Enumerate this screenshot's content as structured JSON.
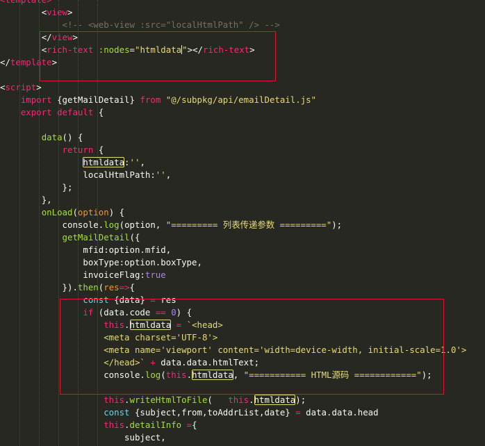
{
  "colors": {
    "background": "#272822",
    "plain": "#f8f8f2",
    "tag": "#f92672",
    "string": "#e6db74",
    "comment": "#75715e",
    "function": "#a6e22e",
    "param": "#fd971f",
    "constant": "#ae81ff",
    "storage": "#66d9ef",
    "highlight_box": "#e0112f"
  },
  "editor": {
    "lines": [
      [
        {
          "t": "<template>",
          "c": "tag"
        }
      ],
      [
        {
          "t": "        "
        },
        {
          "t": "<",
          "c": "plain"
        },
        {
          "t": "view",
          "c": "tag"
        },
        {
          "t": ">",
          "c": "plain"
        }
      ],
      [
        {
          "t": "            "
        },
        {
          "t": "<!-- <web-view :src=\"localHtmlPath\" /> -->",
          "c": "comment"
        }
      ],
      [
        {
          "t": "        "
        },
        {
          "t": "</",
          "c": "plain"
        },
        {
          "t": "view",
          "c": "tag"
        },
        {
          "t": ">",
          "c": "plain"
        }
      ],
      [
        {
          "t": "        "
        },
        {
          "t": "<",
          "c": "plain"
        },
        {
          "t": "rich-text",
          "c": "tag"
        },
        {
          "t": " "
        },
        {
          "t": ":nodes",
          "c": "function"
        },
        {
          "t": "=",
          "c": "plain"
        },
        {
          "t": "\"htmldata",
          "c": "string"
        },
        {
          "cursor": true
        },
        {
          "t": "\"",
          "c": "string"
        },
        {
          "t": "></",
          "c": "plain"
        },
        {
          "t": "rich-text",
          "c": "tag"
        },
        {
          "t": ">",
          "c": "plain"
        }
      ],
      [
        {
          "t": "</",
          "c": "plain"
        },
        {
          "t": "template",
          "c": "tag"
        },
        {
          "t": ">",
          "c": "plain"
        }
      ],
      [],
      [
        {
          "t": "<",
          "c": "plain"
        },
        {
          "t": "script",
          "c": "tag"
        },
        {
          "t": ">",
          "c": "plain"
        }
      ],
      [
        {
          "t": "    "
        },
        {
          "t": "import",
          "c": "tag"
        },
        {
          "t": " {getMailDetail} ",
          "c": "plain"
        },
        {
          "t": "from",
          "c": "tag"
        },
        {
          "t": " "
        },
        {
          "t": "\"@/subpkg/api/emailDetail.js\"",
          "c": "string"
        }
      ],
      [
        {
          "t": "    "
        },
        {
          "t": "export",
          "c": "tag"
        },
        {
          "t": " "
        },
        {
          "t": "default",
          "c": "tag"
        },
        {
          "t": " {",
          "c": "plain"
        }
      ],
      [],
      [
        {
          "t": "        "
        },
        {
          "t": "data",
          "c": "function"
        },
        {
          "t": "() {",
          "c": "plain"
        }
      ],
      [
        {
          "t": "            "
        },
        {
          "t": "return",
          "c": "tag"
        },
        {
          "t": " {",
          "c": "plain"
        }
      ],
      [
        {
          "t": "                "
        },
        {
          "t": "htmldata",
          "c": "plain",
          "box": true
        },
        {
          "t": ":",
          "c": "plain"
        },
        {
          "t": "''",
          "c": "string"
        },
        {
          "t": ",",
          "c": "plain"
        }
      ],
      [
        {
          "t": "                "
        },
        {
          "t": "localHtmlPath:",
          "c": "plain"
        },
        {
          "t": "''",
          "c": "string"
        },
        {
          "t": ",",
          "c": "plain"
        }
      ],
      [
        {
          "t": "            "
        },
        {
          "t": "};",
          "c": "plain"
        }
      ],
      [
        {
          "t": "        "
        },
        {
          "t": "},",
          "c": "plain"
        }
      ],
      [
        {
          "t": "        "
        },
        {
          "t": "onLoad",
          "c": "function"
        },
        {
          "t": "(",
          "c": "plain"
        },
        {
          "t": "option",
          "c": "param"
        },
        {
          "t": ") {",
          "c": "plain"
        }
      ],
      [
        {
          "t": "            "
        },
        {
          "t": "console.",
          "c": "plain"
        },
        {
          "t": "log",
          "c": "function"
        },
        {
          "t": "(option, ",
          "c": "plain"
        },
        {
          "t": "\"========= 列表传递参数 =========\"",
          "c": "string"
        },
        {
          "t": ");",
          "c": "plain"
        }
      ],
      [
        {
          "t": "            "
        },
        {
          "t": "getMailDetail",
          "c": "function"
        },
        {
          "t": "({",
          "c": "plain"
        }
      ],
      [
        {
          "t": "                "
        },
        {
          "t": "mfid:option.mfid,",
          "c": "plain"
        }
      ],
      [
        {
          "t": "                "
        },
        {
          "t": "boxType:option.boxType,",
          "c": "plain"
        }
      ],
      [
        {
          "t": "                "
        },
        {
          "t": "invoiceFlag:",
          "c": "plain"
        },
        {
          "t": "true",
          "c": "constant"
        }
      ],
      [
        {
          "t": "            "
        },
        {
          "t": "}).",
          "c": "plain"
        },
        {
          "t": "then",
          "c": "function"
        },
        {
          "t": "(",
          "c": "plain"
        },
        {
          "t": "res",
          "c": "param"
        },
        {
          "t": "=>",
          "c": "tag"
        },
        {
          "t": "{",
          "c": "plain"
        }
      ],
      [
        {
          "t": "                "
        },
        {
          "t": "const",
          "c": "storage"
        },
        {
          "t": " {data} ",
          "c": "plain"
        },
        {
          "t": "=",
          "c": "tag"
        },
        {
          "t": " res",
          "c": "plain"
        }
      ],
      [
        {
          "t": "                "
        },
        {
          "t": "if",
          "c": "tag"
        },
        {
          "t": " (data.code ",
          "c": "plain"
        },
        {
          "t": "==",
          "c": "tag"
        },
        {
          "t": " "
        },
        {
          "t": "0",
          "c": "constant"
        },
        {
          "t": ") {",
          "c": "plain"
        }
      ],
      [
        {
          "t": "                    "
        },
        {
          "t": "this",
          "c": "tag"
        },
        {
          "t": ".",
          "c": "plain"
        },
        {
          "t": "htmldata",
          "c": "plain",
          "box": true
        },
        {
          "t": " "
        },
        {
          "t": "=",
          "c": "tag"
        },
        {
          "t": " "
        },
        {
          "t": "`<head>",
          "c": "string"
        }
      ],
      [
        {
          "t": "                    "
        },
        {
          "t": "<meta charset='UTF-8'>",
          "c": "string"
        }
      ],
      [
        {
          "t": "                    "
        },
        {
          "t": "<meta name='viewport' content='width=device-width, initial-scale=1.0'>",
          "c": "string"
        }
      ],
      [
        {
          "t": "                    "
        },
        {
          "t": "</head>`",
          "c": "string"
        },
        {
          "t": " "
        },
        {
          "t": "+",
          "c": "tag"
        },
        {
          "t": " data.data.htmlText;",
          "c": "plain"
        }
      ],
      [
        {
          "t": "                    "
        },
        {
          "t": "console.",
          "c": "plain"
        },
        {
          "t": "log",
          "c": "function"
        },
        {
          "t": "(",
          "c": "plain"
        },
        {
          "t": "this",
          "c": "tag"
        },
        {
          "t": ".",
          "c": "plain"
        },
        {
          "t": "htmldata",
          "c": "plain",
          "box": true
        },
        {
          "t": ", ",
          "c": "plain"
        },
        {
          "t": "\"=========== HTML源码 ============\"",
          "c": "string"
        },
        {
          "t": ");",
          "c": "plain"
        }
      ],
      [],
      [
        {
          "t": "                    "
        },
        {
          "t": "this",
          "c": "tag"
        },
        {
          "t": ".",
          "c": "plain"
        },
        {
          "t": "writeHtmlToFile",
          "c": "function"
        },
        {
          "t": "(   ",
          "c": "plain"
        },
        {
          "t": "this",
          "c": "tag"
        },
        {
          "t": ".",
          "c": "plain"
        },
        {
          "t": "htmldata",
          "c": "plain",
          "box": true
        },
        {
          "t": ");",
          "c": "plain"
        }
      ],
      [
        {
          "t": "                    "
        },
        {
          "t": "const",
          "c": "storage"
        },
        {
          "t": " {subject,from,toAddrList,date} ",
          "c": "plain"
        },
        {
          "t": "=",
          "c": "tag"
        },
        {
          "t": " data.data.head",
          "c": "plain"
        }
      ],
      [
        {
          "t": "                    "
        },
        {
          "t": "this",
          "c": "tag"
        },
        {
          "t": ".",
          "c": "plain"
        },
        {
          "t": "detailInfo",
          "c": "function"
        },
        {
          "t": " "
        },
        {
          "t": "=",
          "c": "tag"
        },
        {
          "t": "{",
          "c": "plain"
        }
      ],
      [
        {
          "t": "                        "
        },
        {
          "t": "subject,",
          "c": "plain"
        }
      ]
    ]
  }
}
